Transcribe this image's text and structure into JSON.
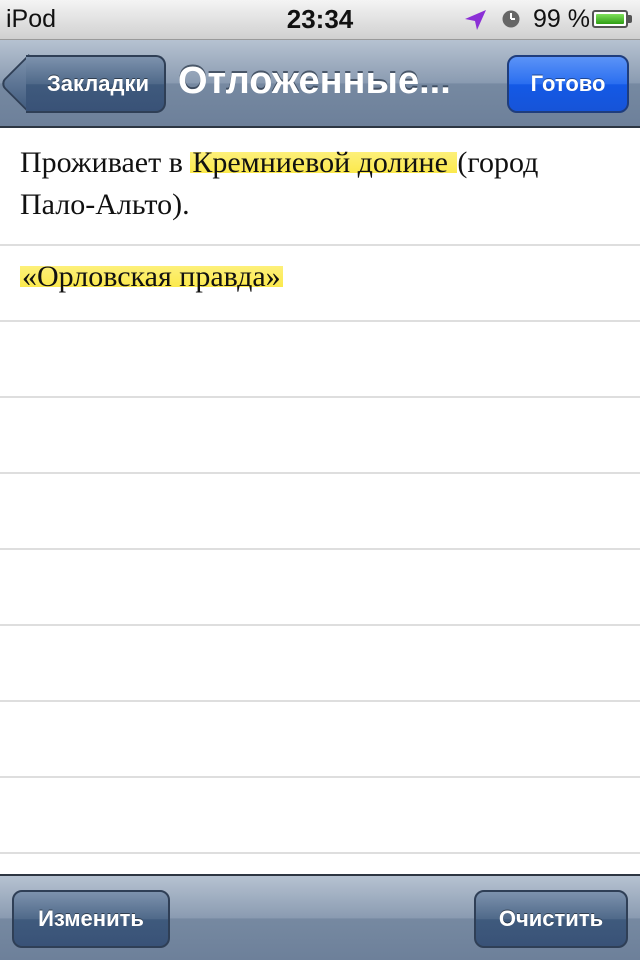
{
  "status_bar": {
    "carrier": "iPod",
    "time": "23:34",
    "battery_text": "99 %",
    "battery_level": 0.99,
    "icons": [
      "location-arrow-icon",
      "alarm-clock-icon",
      "battery-icon"
    ]
  },
  "nav": {
    "back_label": "Закладки",
    "title": "Отложенные...",
    "done_label": "Готово"
  },
  "rows": [
    {
      "before": "Проживает в ",
      "highlight": "Кремниевой долине ",
      "after": "(город Пало-Альто)."
    },
    {
      "before": "",
      "highlight": "«Орловская правда»",
      "after": ""
    }
  ],
  "toolbar": {
    "edit_label": "Изменить",
    "clear_label": "Очистить"
  },
  "colors": {
    "highlight": "#fbe94c",
    "nav_bar": "#8a9bb1",
    "done_button": "#1f6ef0"
  }
}
